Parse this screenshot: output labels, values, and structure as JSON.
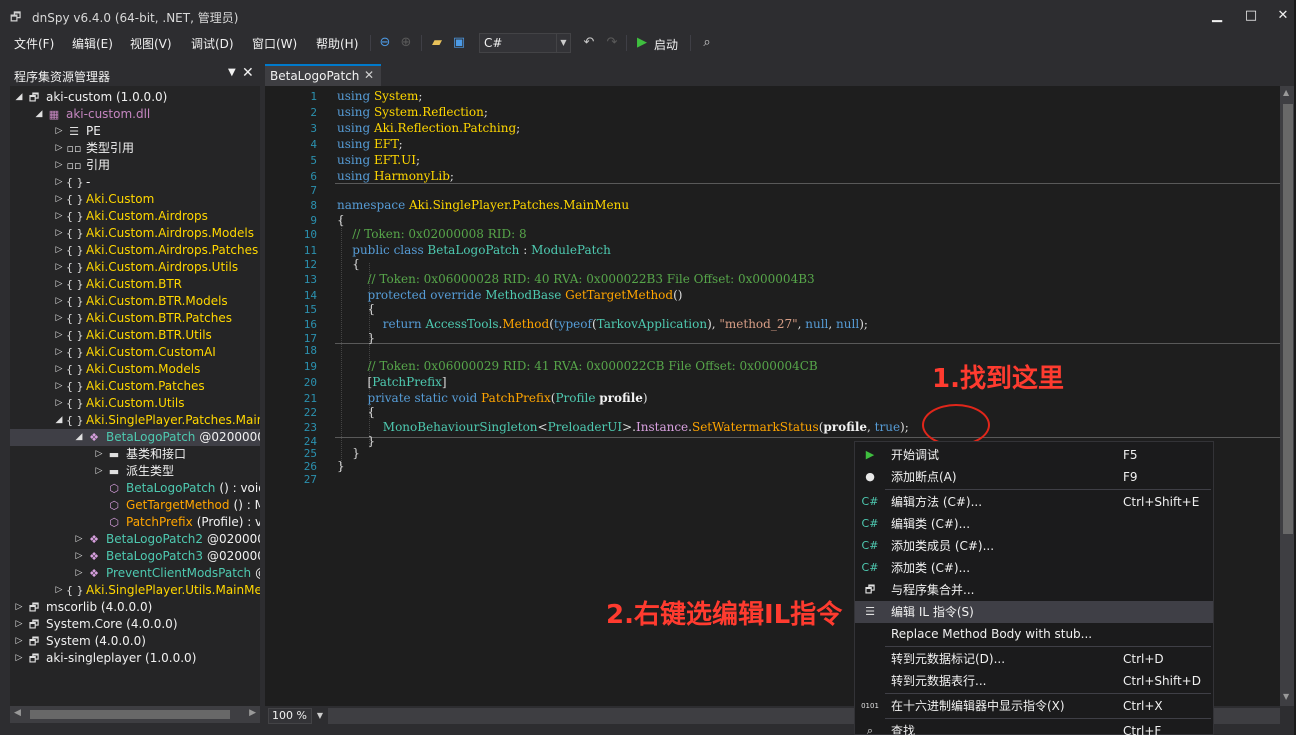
{
  "window": {
    "title": "dnSpy v6.4.0 (64-bit, .NET, 管理员)"
  },
  "menu": [
    "文件(F)",
    "编辑(E)",
    "视图(V)",
    "调试(D)",
    "窗口(W)",
    "帮助(H)"
  ],
  "toolbar": {
    "language": "C#",
    "run_label": "启动"
  },
  "explorer": {
    "title": "程序集资源管理器",
    "rows": [
      {
        "label": "aki-custom (1.0.0.0)",
        "indent": 0,
        "exp": "◢",
        "icon": "🗗",
        "color": "white",
        "icon_name": "assembly-icon"
      },
      {
        "label": "aki-custom.dll",
        "indent": 1,
        "exp": "◢",
        "icon": "▦",
        "color": "dll",
        "icon_name": "module-icon"
      },
      {
        "label": "PE",
        "indent": 2,
        "exp": "▷",
        "icon": "☰",
        "color": "white",
        "icon_name": "pe-icon"
      },
      {
        "label": "类型引用",
        "indent": 2,
        "exp": "▷",
        "icon": "▫▫",
        "color": "white",
        "icon_name": "typeref-icon"
      },
      {
        "label": "引用",
        "indent": 2,
        "exp": "▷",
        "icon": "▫▫",
        "color": "white",
        "icon_name": "reference-icon"
      },
      {
        "label": "-",
        "indent": 2,
        "exp": "▷",
        "icon": "{ }",
        "color": "white",
        "icon_name": "namespace-icon"
      },
      {
        "label": "Aki.Custom",
        "indent": 2,
        "exp": "▷",
        "icon": "{ }",
        "color": "ns",
        "icon_name": "namespace-icon"
      },
      {
        "label": "Aki.Custom.Airdrops",
        "indent": 2,
        "exp": "▷",
        "icon": "{ }",
        "color": "ns",
        "icon_name": "namespace-icon"
      },
      {
        "label": "Aki.Custom.Airdrops.Models",
        "indent": 2,
        "exp": "▷",
        "icon": "{ }",
        "color": "ns",
        "icon_name": "namespace-icon"
      },
      {
        "label": "Aki.Custom.Airdrops.Patches",
        "indent": 2,
        "exp": "▷",
        "icon": "{ }",
        "color": "ns",
        "icon_name": "namespace-icon"
      },
      {
        "label": "Aki.Custom.Airdrops.Utils",
        "indent": 2,
        "exp": "▷",
        "icon": "{ }",
        "color": "ns",
        "icon_name": "namespace-icon"
      },
      {
        "label": "Aki.Custom.BTR",
        "indent": 2,
        "exp": "▷",
        "icon": "{ }",
        "color": "ns",
        "icon_name": "namespace-icon"
      },
      {
        "label": "Aki.Custom.BTR.Models",
        "indent": 2,
        "exp": "▷",
        "icon": "{ }",
        "color": "ns",
        "icon_name": "namespace-icon"
      },
      {
        "label": "Aki.Custom.BTR.Patches",
        "indent": 2,
        "exp": "▷",
        "icon": "{ }",
        "color": "ns",
        "icon_name": "namespace-icon"
      },
      {
        "label": "Aki.Custom.BTR.Utils",
        "indent": 2,
        "exp": "▷",
        "icon": "{ }",
        "color": "ns",
        "icon_name": "namespace-icon"
      },
      {
        "label": "Aki.Custom.CustomAI",
        "indent": 2,
        "exp": "▷",
        "icon": "{ }",
        "color": "ns",
        "icon_name": "namespace-icon"
      },
      {
        "label": "Aki.Custom.Models",
        "indent": 2,
        "exp": "▷",
        "icon": "{ }",
        "color": "ns",
        "icon_name": "namespace-icon"
      },
      {
        "label": "Aki.Custom.Patches",
        "indent": 2,
        "exp": "▷",
        "icon": "{ }",
        "color": "ns",
        "icon_name": "namespace-icon"
      },
      {
        "label": "Aki.Custom.Utils",
        "indent": 2,
        "exp": "▷",
        "icon": "{ }",
        "color": "ns",
        "icon_name": "namespace-icon"
      },
      {
        "label": "Aki.SinglePlayer.Patches.Main",
        "indent": 2,
        "exp": "◢",
        "icon": "{ }",
        "color": "ns",
        "icon_name": "namespace-icon"
      },
      {
        "label": "BetaLogoPatch",
        "suffix": "@0200000",
        "indent": 3,
        "exp": "◢",
        "icon": "❖",
        "color": "type",
        "icon_name": "class-icon",
        "selected": true
      },
      {
        "label": "基类和接口",
        "indent": 4,
        "exp": "▷",
        "icon": "▬",
        "color": "white",
        "icon_name": "folder-icon"
      },
      {
        "label": "派生类型",
        "indent": 4,
        "exp": "▷",
        "icon": "▬",
        "color": "white",
        "icon_name": "folder-icon"
      },
      {
        "label": "BetaLogoPatch",
        "suffix": "() : void",
        "indent": 4,
        "exp": "",
        "icon": "⬡",
        "color": "type",
        "icon_name": "constructor-icon"
      },
      {
        "label": "GetTargetMethod",
        "suffix": "() : M",
        "indent": 4,
        "exp": "",
        "icon": "⬡",
        "color": "method",
        "icon_name": "method-icon"
      },
      {
        "label": "PatchPrefix",
        "suffix": "(Profile) : vo",
        "indent": 4,
        "exp": "",
        "icon": "⬡",
        "color": "method",
        "icon_name": "method-icon"
      },
      {
        "label": "BetaLogoPatch2",
        "suffix": "@020000",
        "indent": 3,
        "exp": "▷",
        "icon": "❖",
        "color": "type",
        "icon_name": "class-icon"
      },
      {
        "label": "BetaLogoPatch3",
        "suffix": "@020000",
        "indent": 3,
        "exp": "▷",
        "icon": "❖",
        "color": "type",
        "icon_name": "class-icon"
      },
      {
        "label": "PreventClientModsPatch",
        "suffix": "@",
        "indent": 3,
        "exp": "▷",
        "icon": "❖",
        "color": "type",
        "icon_name": "class-icon"
      },
      {
        "label": "Aki.SinglePlayer.Utils.MainMe",
        "indent": 2,
        "exp": "▷",
        "icon": "{ }",
        "color": "ns",
        "icon_name": "namespace-icon"
      },
      {
        "label": "mscorlib (4.0.0.0)",
        "indent": 0,
        "exp": "▷",
        "icon": "🗗",
        "color": "white",
        "icon_name": "assembly-icon"
      },
      {
        "label": "System.Core (4.0.0.0)",
        "indent": 0,
        "exp": "▷",
        "icon": "🗗",
        "color": "white",
        "icon_name": "assembly-icon"
      },
      {
        "label": "System (4.0.0.0)",
        "indent": 0,
        "exp": "▷",
        "icon": "🗗",
        "color": "white",
        "icon_name": "assembly-icon"
      },
      {
        "label": "aki-singleplayer (1.0.0.0)",
        "indent": 0,
        "exp": "▷",
        "icon": "🗗",
        "color": "white",
        "icon_name": "assembly-icon"
      }
    ]
  },
  "editor": {
    "tab_label": "BetaLogoPatch",
    "zoom": "100 %",
    "line_numbers": [
      "1",
      "2",
      "3",
      "4",
      "5",
      "6",
      "7",
      "8",
      "9",
      "10",
      "11",
      "12",
      "13",
      "14",
      "15",
      "16",
      "17",
      "18",
      "19",
      "20",
      "21",
      "22",
      "23",
      "24",
      "25",
      "26",
      "27"
    ],
    "lines": [
      [
        [
          "k",
          "using "
        ],
        [
          "ns",
          "System"
        ],
        [
          "p",
          ";"
        ]
      ],
      [
        [
          "k",
          "using "
        ],
        [
          "ns",
          "System.Reflection"
        ],
        [
          "p",
          ";"
        ]
      ],
      [
        [
          "k",
          "using "
        ],
        [
          "ns",
          "Aki.Reflection.Patching"
        ],
        [
          "p",
          ";"
        ]
      ],
      [
        [
          "k",
          "using "
        ],
        [
          "ns",
          "EFT"
        ],
        [
          "p",
          ";"
        ]
      ],
      [
        [
          "k",
          "using "
        ],
        [
          "ns",
          "EFT.UI"
        ],
        [
          "p",
          ";"
        ]
      ],
      [
        [
          "k",
          "using "
        ],
        [
          "ns",
          "HarmonyLib"
        ],
        [
          "p",
          ";"
        ]
      ],
      [],
      [
        [
          "k",
          "namespace "
        ],
        [
          "ns",
          "Aki.SinglePlayer.Patches.MainMenu"
        ]
      ],
      [
        [
          "p",
          "{"
        ]
      ],
      [
        [
          "p",
          "    "
        ],
        [
          "cm",
          "// Token: 0x02000008 RID: 8"
        ]
      ],
      [
        [
          "p",
          "    "
        ],
        [
          "k",
          "public class "
        ],
        [
          "t",
          "BetaLogoPatch"
        ],
        [
          "p",
          " : "
        ],
        [
          "t",
          "ModulePatch"
        ]
      ],
      [
        [
          "p",
          "    {"
        ]
      ],
      [
        [
          "p",
          "        "
        ],
        [
          "cm",
          "// Token: 0x06000028 RID: 40 RVA: 0x000022B3 File Offset: 0x000004B3"
        ]
      ],
      [
        [
          "p",
          "        "
        ],
        [
          "k",
          "protected override "
        ],
        [
          "t",
          "MethodBase "
        ],
        [
          "m",
          "GetTargetMethod"
        ],
        [
          "p",
          "()"
        ]
      ],
      [
        [
          "p",
          "        {"
        ]
      ],
      [
        [
          "p",
          "            "
        ],
        [
          "k",
          "return "
        ],
        [
          "t",
          "AccessTools"
        ],
        [
          "p",
          "."
        ],
        [
          "m",
          "Method"
        ],
        [
          "p",
          "("
        ],
        [
          "k",
          "typeof"
        ],
        [
          "p",
          "("
        ],
        [
          "t",
          "TarkovApplication"
        ],
        [
          "p",
          "), "
        ],
        [
          "s",
          "\"method_27\""
        ],
        [
          "p",
          ", "
        ],
        [
          "k",
          "null"
        ],
        [
          "p",
          ", "
        ],
        [
          "k",
          "null"
        ],
        [
          "p",
          ");"
        ]
      ],
      [
        [
          "p",
          "        }"
        ]
      ],
      [],
      [
        [
          "p",
          "        "
        ],
        [
          "cm",
          "// Token: 0x06000029 RID: 41 RVA: 0x000022CB File Offset: 0x000004CB"
        ]
      ],
      [
        [
          "p",
          "        ["
        ],
        [
          "t",
          "PatchPrefix"
        ],
        [
          "p",
          "]"
        ]
      ],
      [
        [
          "p",
          "        "
        ],
        [
          "k",
          "private static void "
        ],
        [
          "m",
          "PatchPrefix"
        ],
        [
          "p",
          "("
        ],
        [
          "t",
          "Profile "
        ],
        [
          "b",
          "profile"
        ],
        [
          "p",
          ")"
        ]
      ],
      [
        [
          "p",
          "        {"
        ]
      ],
      [
        [
          "p",
          "            "
        ],
        [
          "t",
          "MonoBehaviourSingleton"
        ],
        [
          "p",
          "<"
        ],
        [
          "t",
          "PreloaderUI"
        ],
        [
          "p",
          ">."
        ],
        [
          "ty",
          "Instance"
        ],
        [
          "p",
          "."
        ],
        [
          "m",
          "SetWatermarkStatus"
        ],
        [
          "p",
          "("
        ],
        [
          "b",
          "profile"
        ],
        [
          "p",
          ", "
        ],
        [
          "k",
          "true"
        ],
        [
          "p",
          ");"
        ]
      ],
      [
        [
          "p",
          "        }"
        ]
      ],
      [
        [
          "p",
          "    }"
        ]
      ],
      [
        [
          "p",
          "}"
        ]
      ],
      []
    ]
  },
  "annotations": {
    "step1": "1.找到这里",
    "step2": "2.右键选编辑IL指令"
  },
  "context_menu": {
    "items": [
      {
        "icon": "▶",
        "icon_color": "#3fbf3f",
        "icon_name": "start-debug-icon",
        "label": "开始调试",
        "shortcut": "F5",
        "sep_after": false
      },
      {
        "icon": "●",
        "icon_color": "#e8e8e8",
        "icon_name": "breakpoint-icon",
        "label": "添加断点(A)",
        "shortcut": "F9",
        "sep_after": true
      },
      {
        "icon": "C#",
        "icon_color": "#4ec9b0",
        "icon_name": "csharp-icon",
        "label": "编辑方法 (C#)...",
        "shortcut": "Ctrl+Shift+E",
        "sep_after": false
      },
      {
        "icon": "C#",
        "icon_color": "#4ec9b0",
        "icon_name": "csharp-icon",
        "label": "编辑类 (C#)...",
        "shortcut": "",
        "sep_after": false
      },
      {
        "icon": "C#",
        "icon_color": "#4ec9b0",
        "icon_name": "csharp-icon",
        "label": "添加类成员 (C#)...",
        "shortcut": "",
        "sep_after": false
      },
      {
        "icon": "C#",
        "icon_color": "#4ec9b0",
        "icon_name": "csharp-icon",
        "label": "添加类 (C#)...",
        "shortcut": "",
        "sep_after": false
      },
      {
        "icon": "🗗",
        "icon_color": "#e0e0e0",
        "icon_name": "merge-assembly-icon",
        "label": "与程序集合并...",
        "shortcut": "",
        "sep_after": false
      },
      {
        "icon": "☰",
        "icon_color": "#e0e0e0",
        "icon_name": "il-edit-icon",
        "label": "编辑 IL 指令(S)",
        "shortcut": "",
        "sep_after": false,
        "highlight": true
      },
      {
        "icon": "",
        "icon_color": "#e0e0e0",
        "icon_name": "",
        "label": "Replace Method Body with stub...",
        "shortcut": "",
        "sep_after": true
      },
      {
        "icon": "",
        "icon_color": "#e0e0e0",
        "icon_name": "",
        "label": "转到元数据标记(D)...",
        "shortcut": "Ctrl+D",
        "sep_after": false
      },
      {
        "icon": "",
        "icon_color": "#e0e0e0",
        "icon_name": "",
        "label": "转到元数据表行...",
        "shortcut": "Ctrl+Shift+D",
        "sep_after": true
      },
      {
        "icon": "0101",
        "icon_color": "#e0e0e0",
        "icon_name": "hex-editor-icon",
        "label": "在十六进制编辑器中显示指令(X)",
        "shortcut": "Ctrl+X",
        "sep_after": true
      },
      {
        "icon": "⌕",
        "icon_color": "#e0e0e0",
        "icon_name": "search-icon",
        "label": "查找",
        "shortcut": "Ctrl+F",
        "sep_after": false
      }
    ]
  },
  "colors": {
    "accent": "#007acc",
    "annotation": "#ff3b2f"
  }
}
